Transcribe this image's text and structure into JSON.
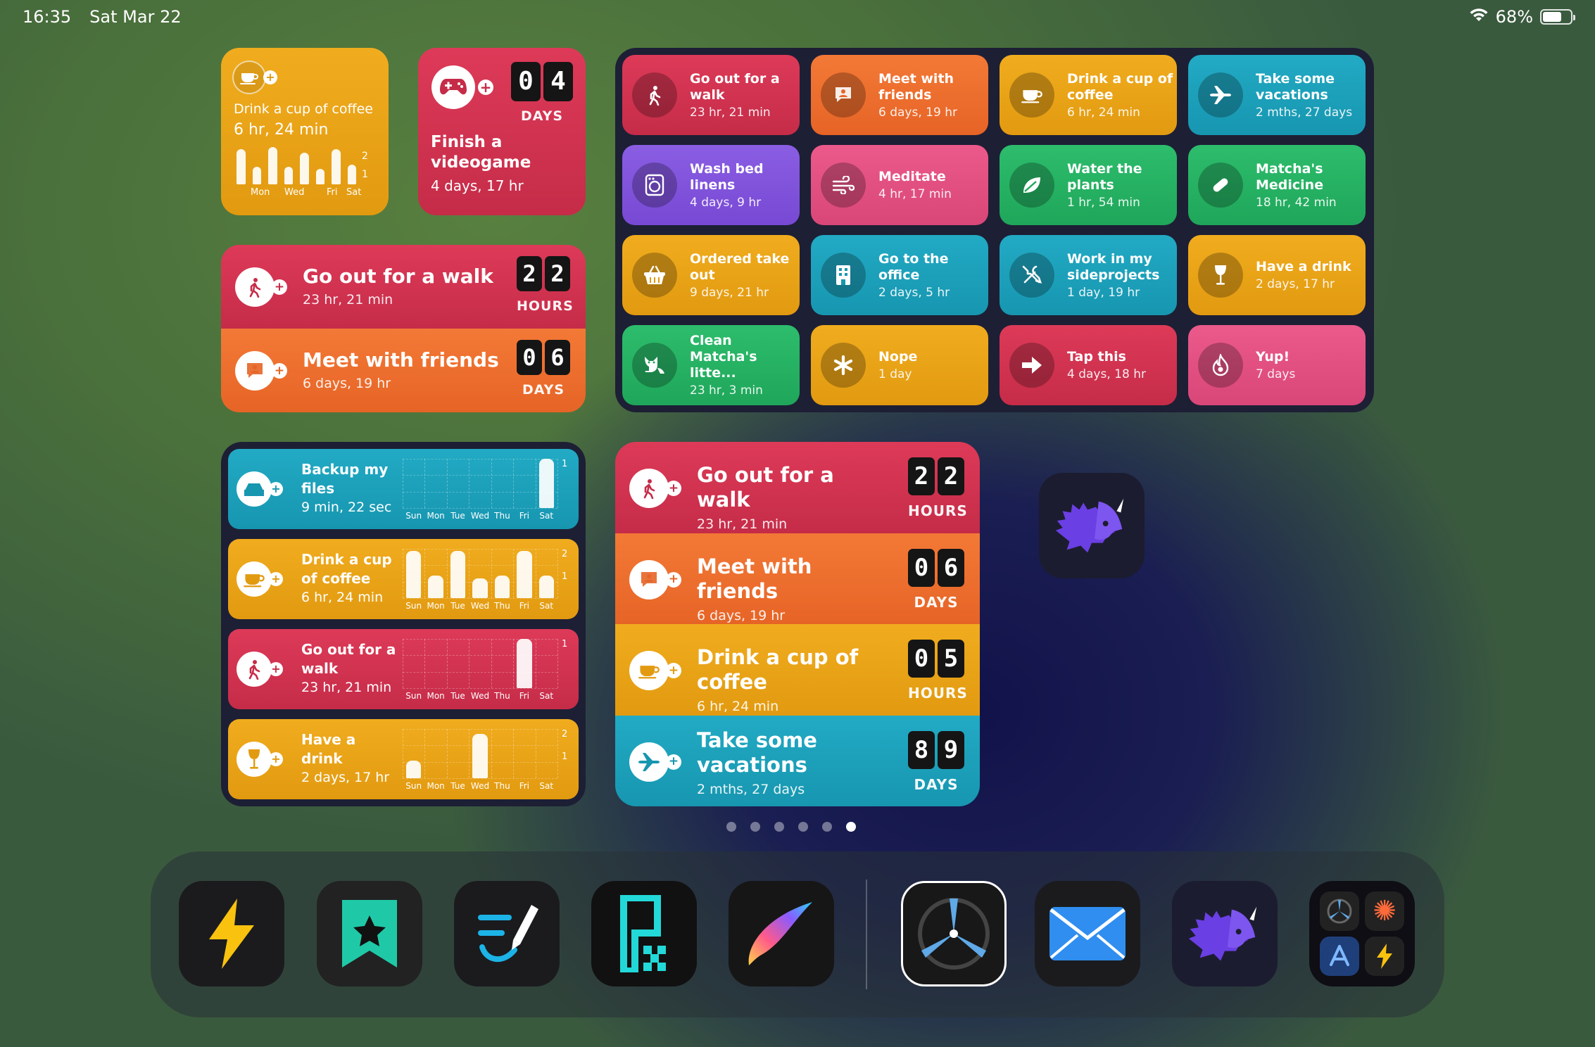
{
  "status": {
    "time": "16:35",
    "date": "Sat Mar 22",
    "battery": "68%",
    "battery_level": 0.68
  },
  "w_coffee_small": {
    "title": "Drink a cup of coffee",
    "elapsed": "6 hr, 24 min",
    "axis_top": "2",
    "axis_mid": "1",
    "days": [
      "Mon",
      "Wed",
      "Fri",
      "Sat"
    ],
    "bars": [
      1.8,
      0.9,
      1.9,
      0.9,
      1.6,
      0.8,
      1.8,
      1.0
    ]
  },
  "w_videogame": {
    "d1": "0",
    "d2": "4",
    "unit": "DAYS",
    "title": "Finish a videogame",
    "elapsed": "4 days, 17 hr"
  },
  "w_walk_meet": [
    {
      "title": "Go out for a walk",
      "elapsed": "23 hr, 21 min",
      "d1": "2",
      "d2": "2",
      "unit": "HOURS"
    },
    {
      "title": "Meet with friends",
      "elapsed": "6 days, 19 hr",
      "d1": "0",
      "d2": "6",
      "unit": "DAYS"
    }
  ],
  "grid": [
    {
      "title": "Go out for a walk",
      "elapsed": "23 hr, 21 min",
      "color": "red",
      "icon": "walk-icon"
    },
    {
      "title": "Meet with friends",
      "elapsed": "6 days, 19 hr",
      "color": "orange",
      "icon": "chat-person-icon"
    },
    {
      "title": "Drink a cup of coffee",
      "elapsed": "6 hr, 24 min",
      "color": "yellow",
      "icon": "coffee-icon"
    },
    {
      "title": "Take some vacations",
      "elapsed": "2 mths, 27 days",
      "color": "teal",
      "icon": "airplane-icon"
    },
    {
      "title": "Wash bed linens",
      "elapsed": "4 days, 9 hr",
      "color": "purple",
      "icon": "washer-icon"
    },
    {
      "title": "Meditate",
      "elapsed": "4 hr, 17 min",
      "color": "pink",
      "icon": "wind-icon"
    },
    {
      "title": "Water the plants",
      "elapsed": "1 hr, 54 min",
      "color": "green",
      "icon": "leaf-icon"
    },
    {
      "title": "Matcha's Medicine",
      "elapsed": "18 hr, 42 min",
      "color": "green",
      "icon": "pill-icon"
    },
    {
      "title": "Ordered take out",
      "elapsed": "9 days, 21 hr",
      "color": "yellow",
      "icon": "basket-icon"
    },
    {
      "title": "Go to the office",
      "elapsed": "2 days, 5 hr",
      "color": "teal",
      "icon": "building-icon"
    },
    {
      "title": "Work in my sideprojects",
      "elapsed": "1 day, 19 hr",
      "color": "teal",
      "icon": "tools-icon"
    },
    {
      "title": "Have a drink",
      "elapsed": "2 days, 17 hr",
      "color": "yellow",
      "icon": "wine-glass-icon"
    },
    {
      "title": "Clean Matcha's litte...",
      "elapsed": "23 hr, 3 min",
      "color": "green",
      "icon": "cat-icon"
    },
    {
      "title": "Nope",
      "elapsed": "1 day",
      "color": "yellow",
      "icon": "asterisk-icon"
    },
    {
      "title": "Tap this",
      "elapsed": "4 days, 18 hr",
      "color": "red",
      "icon": "arrow-right-icon"
    },
    {
      "title": "Yup!",
      "elapsed": "7 days",
      "color": "pink",
      "icon": "flame-icon"
    }
  ],
  "charts": [
    {
      "title": "Backup my files",
      "elapsed": "9 min, 22 sec",
      "color": "teal",
      "icon": "drive-icon",
      "ymax_label": "1",
      "ymid_label": "",
      "bars": [
        0,
        0,
        0,
        0,
        0,
        0,
        1
      ],
      "ymax": 1
    },
    {
      "title": "Drink a cup of coffee",
      "elapsed": "6 hr, 24 min",
      "color": "yellow",
      "icon": "coffee-icon",
      "ymax_label": "2",
      "ymid_label": "1",
      "bars": [
        1.9,
        0.9,
        1.9,
        0.8,
        0.9,
        1.9,
        0.9
      ],
      "ymax": 2
    },
    {
      "title": "Go out for a walk",
      "elapsed": "23 hr, 21 min",
      "color": "red",
      "icon": "walk-icon",
      "ymax_label": "1",
      "ymid_label": "",
      "bars": [
        0,
        0,
        0,
        0,
        0,
        1,
        0
      ],
      "ymax": 1
    },
    {
      "title": "Have a drink",
      "elapsed": "2 days, 17 hr",
      "color": "yellow",
      "icon": "wine-glass-icon",
      "ymax_label": "2",
      "ymid_label": "1",
      "bars": [
        0.7,
        0,
        0,
        1.8,
        0,
        0,
        0
      ],
      "ymax": 2
    }
  ],
  "chart_days": [
    "Sun",
    "Mon",
    "Tue",
    "Wed",
    "Thu",
    "Fri",
    "Sat"
  ],
  "big": [
    {
      "title": "Go out for a walk",
      "elapsed": "23 hr, 21 min",
      "d1": "2",
      "d2": "2",
      "unit": "HOURS",
      "color": "red",
      "icon": "walk-icon"
    },
    {
      "title": "Meet with friends",
      "elapsed": "6 days, 19 hr",
      "d1": "0",
      "d2": "6",
      "unit": "DAYS",
      "color": "orange",
      "icon": "chat-person-icon"
    },
    {
      "title": "Drink a cup of coffee",
      "elapsed": "6 hr, 24 min",
      "d1": "0",
      "d2": "5",
      "unit": "HOURS",
      "color": "yellow",
      "icon": "coffee-icon"
    },
    {
      "title": "Take some vacations",
      "elapsed": "2 mths, 27 days",
      "d1": "8",
      "d2": "9",
      "unit": "DAYS",
      "color": "teal",
      "icon": "airplane-icon"
    }
  ],
  "pages": {
    "count": 6,
    "current": 6
  },
  "dock": [
    "bolt-app-icon",
    "bookmark-star-app-icon",
    "writing-app-icon",
    "qr-app-icon",
    "procreate-app-icon",
    "tripsy-app-icon",
    "mail-app-icon",
    "triceratops-app-icon",
    "app-folder-icon"
  ]
}
